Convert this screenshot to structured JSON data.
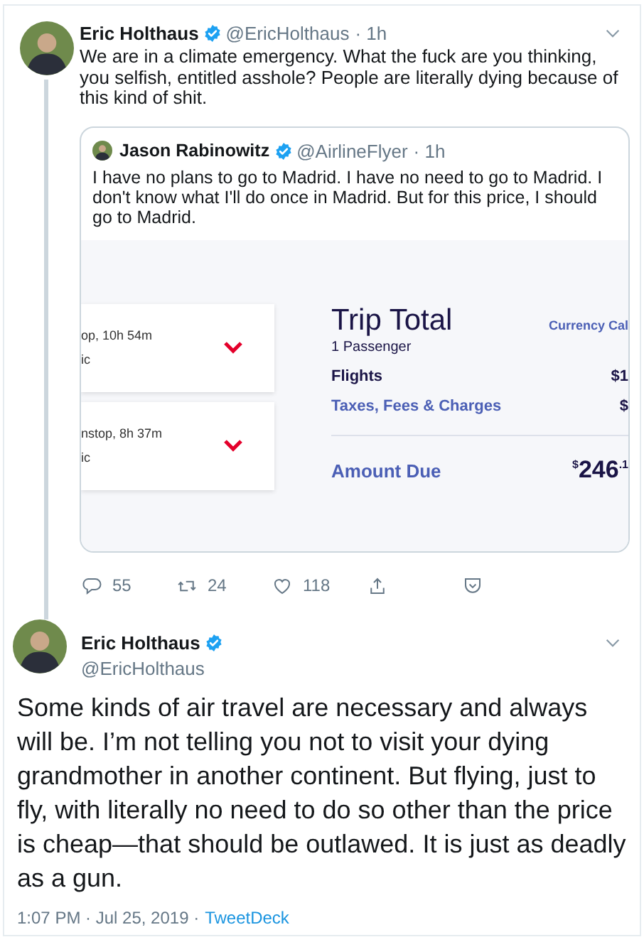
{
  "tweet": {
    "author": "Eric Holthaus",
    "verified": true,
    "handle": "@EricHolthaus",
    "time": "· 1h",
    "text": "We are in a climate emergency. What the fuck are you thinking, you selfish, entitled asshole? People are literally dying because of this kind of shit.",
    "quote": {
      "author": "Jason Rabinowitz",
      "verified": true,
      "handle": "@AirlineFlyer",
      "time": "· 1h",
      "text": "I have no plans to go to Madrid. I have no need to go to Madrid. I don't know what I'll do once in Madrid. But for this price, I should go to Madrid.",
      "screenshot": {
        "flights": [
          {
            "line1": "op, 10h 54m",
            "line2": "ic"
          },
          {
            "line1": "nstop, 8h 37m",
            "line2": "ic"
          }
        ],
        "title": "Trip Total",
        "link": "Currency Cal",
        "passengers": "1 Passenger",
        "rows": [
          {
            "kind": "plain",
            "label": "Flights",
            "amount": "$1"
          },
          {
            "kind": "link",
            "label": "Taxes, Fees & Charges",
            "amount": "$"
          }
        ],
        "due_label": "Amount Due",
        "due_amount": "$^{$}$246$^{.1}$"
      }
    },
    "actions": [
      {
        "kind": "reply",
        "count": "55"
      },
      {
        "kind": "retweet",
        "count": "24"
      },
      {
        "kind": "like",
        "count": "118"
      },
      {
        "kind": "share"
      },
      {
        "kind": "save"
      }
    ]
  },
  "reply": {
    "author": "Eric Holthaus",
    "verified": true,
    "handle": "@EricHolthaus",
    "text": "Some kinds of air travel are necessary and always will be. I’m not telling you not to visit your dying grandmother in another continent. But flying, just to fly, with literally no need to do so other than the price is cheap—that should be outlawed. It is just as deadly as a gun.",
    "meta": "1:07 PM · Jul 25, 2019 ·",
    "source": "TweetDeck"
  }
}
